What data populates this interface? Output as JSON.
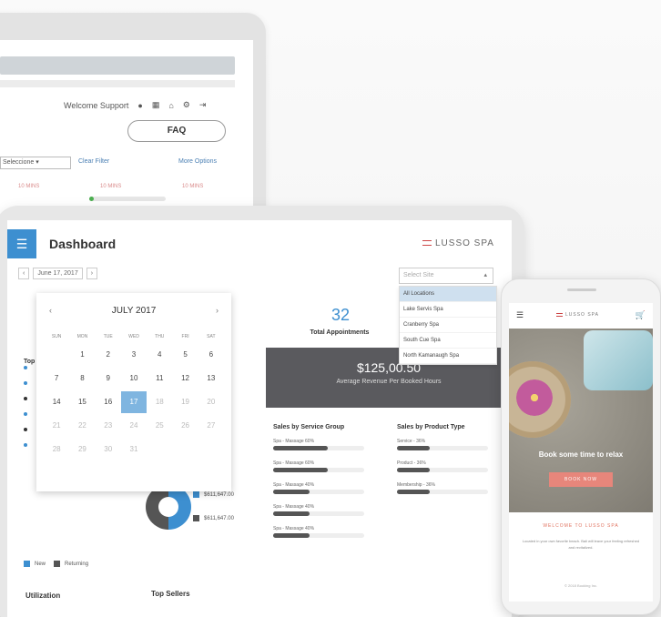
{
  "back_window": {
    "welcome": "Welcome Support",
    "faq": "FAQ",
    "filter_value": "Seleccione",
    "clear_filter": "Clear Filter",
    "more_options": "More Options",
    "red_labels": [
      "10 MINS",
      "10 MINS",
      "10 MINS"
    ],
    "progress_fraction": 0.06
  },
  "dashboard": {
    "title": "Dashboard",
    "brand": "LUSSO SPA",
    "date_range": "June 17, 2017",
    "select_placeholder": "Select Site",
    "dropdown": [
      "All Locations",
      "Lake Servis Spa",
      "Cranberry Spa",
      "South Cue Spa",
      "North Kamanaugh Spa"
    ],
    "calendar": {
      "month": "JULY 2017",
      "prev": "‹",
      "next": "›",
      "weekdays": [
        "SUN",
        "MON",
        "TUE",
        "WED",
        "THU",
        "FRI",
        "SAT"
      ],
      "days": [
        [
          "",
          "",
          "",
          "",
          "",
          "",
          "1"
        ],
        [
          "",
          "1",
          "2",
          "3",
          "4",
          "5",
          "6"
        ],
        [
          "7",
          "8",
          "9",
          "10",
          "11",
          "12",
          "13"
        ],
        [
          "14",
          "15",
          "16",
          "17",
          "18",
          "19",
          "20"
        ],
        [
          "21",
          "22",
          "23",
          "24",
          "25",
          "26",
          "27"
        ],
        [
          "28",
          "29",
          "30",
          "31",
          "",
          "",
          ""
        ]
      ]
    },
    "total_appointments": "32",
    "total_appointments_label": "Total Appointments",
    "revenue": "$125,00.50",
    "revenue_label": "Average Revenue Per Booked Hours",
    "sales_by_service_group": "Sales by Service Group",
    "sales_by_product_type": "Sales by Product Type",
    "service_rows": [
      {
        "label": "Spa - Massage 60%",
        "value": 0.6
      },
      {
        "label": "Spa - Massage 60%",
        "value": 0.6
      },
      {
        "label": "Spa - Massage 40%",
        "value": 0.4
      },
      {
        "label": "Spa - Massage 40%",
        "value": 0.4
      },
      {
        "label": "Spa - Massage 40%",
        "value": 0.4
      }
    ],
    "product_rows": [
      {
        "label": "Service - 36%",
        "value": 0.36
      },
      {
        "label": "Product - 36%",
        "value": 0.36
      },
      {
        "label": "Membership - 36%",
        "value": 0.36
      }
    ],
    "top_label": "Top",
    "legend_values": [
      "$611,647.00",
      "$611,647.00"
    ],
    "legend_new": "New",
    "legend_returning": "Returning",
    "utilization": "Utilization",
    "top_sellers": "Top Sellers"
  },
  "phone": {
    "brand": "LUSSO SPA",
    "hero_text": "Book some time to relax",
    "hero_button": "BOOK NOW",
    "welcome": "WELCOME TO LUSSO SPA",
    "body": "Located in your own favorite beach. Bali will leave your feeling refreshed and revitalized.",
    "footer": "© 2018 Booking Inc."
  },
  "colors": {
    "accent": "#3d8fd0",
    "dark": "#5a5a5e",
    "coral": "#e7867b"
  }
}
